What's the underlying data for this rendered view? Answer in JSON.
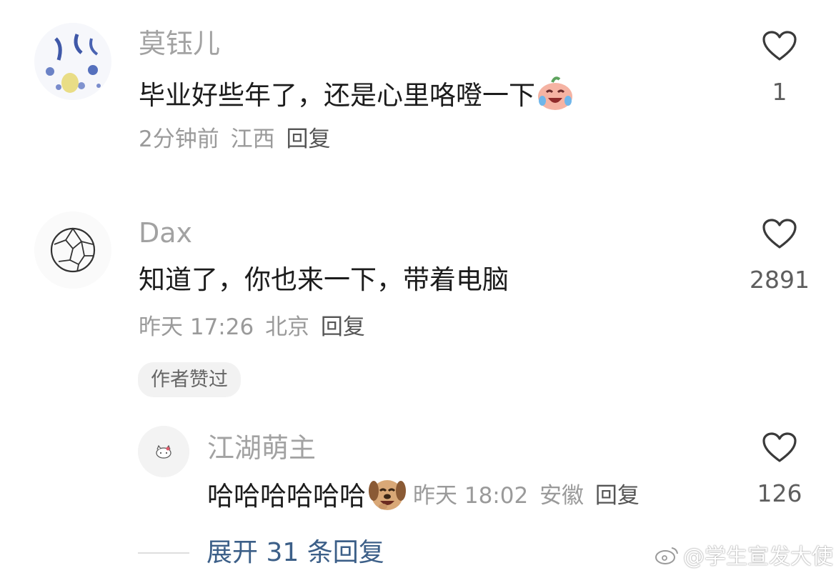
{
  "comments": [
    {
      "username": "莫钰儿",
      "text": "毕业好些年了，还是心里咯噔一下",
      "emoji": "laugh-cry-emoji",
      "time": "2分钟前",
      "location": "江西",
      "reply_label": "回复",
      "likes": "1"
    },
    {
      "username": "Dax",
      "text": "知道了，你也来一下，带着电脑",
      "time": "昨天 17:26",
      "location": "北京",
      "reply_label": "回复",
      "likes": "2891",
      "badge": "作者赞过",
      "sub_reply": {
        "username": "江湖萌主",
        "text": "哈哈哈哈哈哈",
        "emoji": "dog-laugh-emoji",
        "time": "昨天 18:02",
        "location": "安徽",
        "reply_label": "回复",
        "likes": "126"
      },
      "expand_label": "展开 31 条回复"
    }
  ],
  "watermark": "@学生宣发大使",
  "colors": {
    "username": "#a2a2a2",
    "text": "#1c1c1c",
    "meta": "#9a9a9a",
    "link": "#3c5f88",
    "badge_bg": "#f2f2f2"
  }
}
